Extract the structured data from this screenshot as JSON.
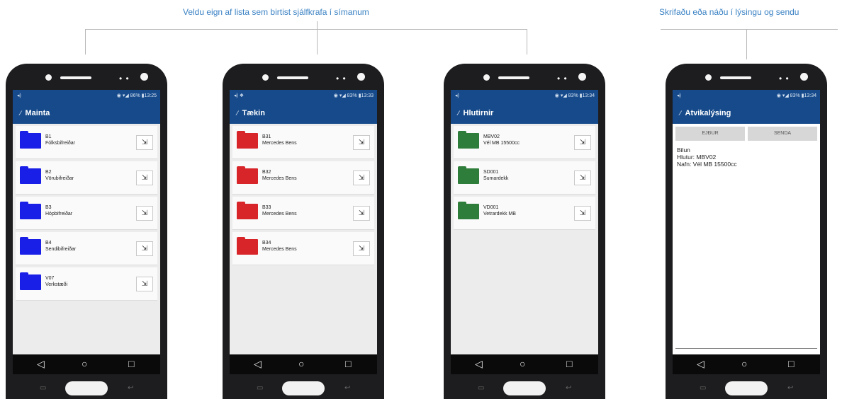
{
  "captions": {
    "left": "Veldu eign af lista sem birtist sjálfkrafa í símanum",
    "right": "Skrifaðu eða náðu í lýsingu og sendu"
  },
  "colors": {
    "statusbar": "#164a8b",
    "folder_blue": "#1a1fe8",
    "folder_red": "#d7252a",
    "folder_green": "#2f7d3a",
    "caption": "#3b82c4"
  },
  "status": {
    "left_1": "◂)",
    "left_2": "◂) ❖",
    "right_1": "◉ ▾◢ 86% ▮13:25",
    "right_2": "◉ ▾◢ 83% ▮13:33",
    "right_3": "◉ ▾◢ 83% ▮13:34",
    "right_4": "◉ ▾◢ 83% ▮13:34"
  },
  "navbar": {
    "back": "◁",
    "home": "○",
    "recent": "□"
  },
  "screens": [
    {
      "title": "Mainta",
      "folder_color": "blue",
      "items": [
        {
          "code": "B1",
          "name": "Fólksbifreiðar"
        },
        {
          "code": "B2",
          "name": "Vörubifreiðar"
        },
        {
          "code": "B3",
          "name": "Hópbifreiðar"
        },
        {
          "code": "B4",
          "name": "Sendibifreiðar"
        },
        {
          "code": "V07",
          "name": "Verkstæði"
        }
      ]
    },
    {
      "title": "Tækin",
      "folder_color": "red",
      "items": [
        {
          "code": "B31",
          "name": "Mercedes Bens"
        },
        {
          "code": "B32",
          "name": "Mercedes Bens"
        },
        {
          "code": "B33",
          "name": "Mercedes Bens"
        },
        {
          "code": "B34",
          "name": "Mercedes Bens"
        }
      ]
    },
    {
      "title": "Hlutirnir",
      "folder_color": "green",
      "items": [
        {
          "code": "MBV02",
          "name": "Vél MB 15500cc"
        },
        {
          "code": "SD001",
          "name": "Sumardekk"
        },
        {
          "code": "VD001",
          "name": "Vetrardekk MB"
        }
      ]
    },
    {
      "title": "Atvikalýsing",
      "buttons": {
        "clear": "EJÐUR",
        "send": "SENDA"
      },
      "text": {
        "line1": "Bilun",
        "line2": "Hlutur: MBV02",
        "line3": "Nafn: Vél MB 15500cc"
      }
    }
  ]
}
